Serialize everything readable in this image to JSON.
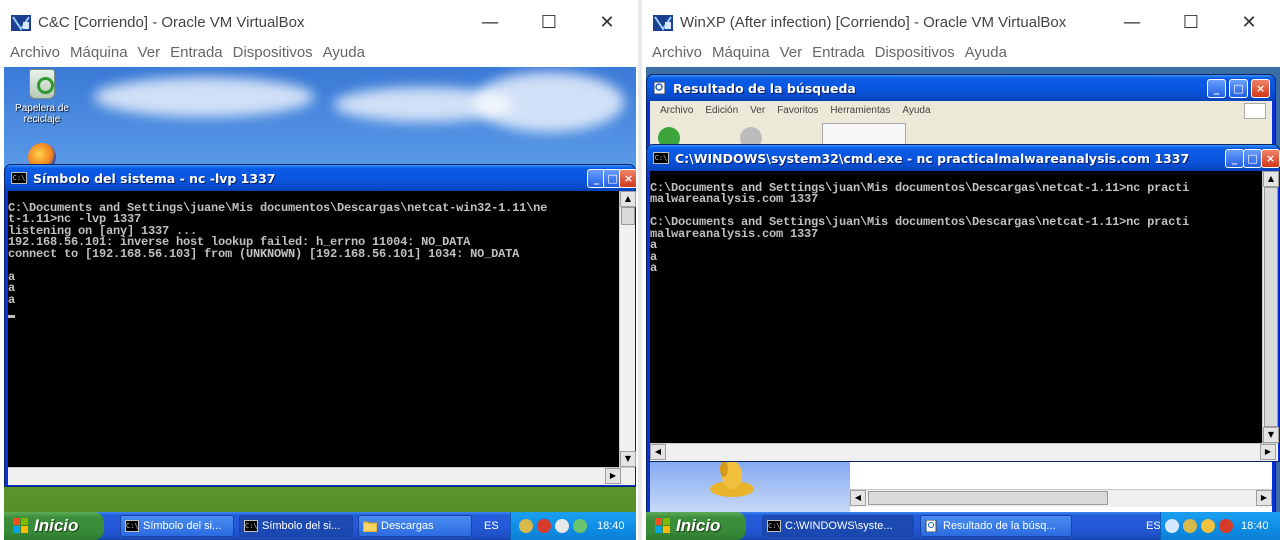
{
  "left_vm": {
    "window_title": "C&C [Corriendo] - Oracle VM VirtualBox",
    "menu": [
      "Archivo",
      "Máquina",
      "Ver",
      "Entrada",
      "Dispositivos",
      "Ayuda"
    ],
    "desktop_icons": [
      {
        "label": "Papelera de reciclaje",
        "icon": "recycle-bin-icon"
      },
      {
        "label": "",
        "icon": "firefox-icon"
      }
    ],
    "cmd_window": {
      "title": "Símbolo del sistema - nc -lvp 1337",
      "lines": [
        "",
        "C:\\Documents and Settings\\juane\\Mis documentos\\Descargas\\netcat-win32-1.11\\ne",
        "t-1.11>nc -lvp 1337",
        "listening on [any] 1337 ...",
        "192.168.56.101: inverse host lookup failed: h_errno 11004: NO_DATA",
        "connect to [192.168.56.103] from (UNKNOWN) [192.168.56.101] 1034: NO_DATA",
        "",
        "a",
        "a",
        "a"
      ]
    },
    "taskbar": {
      "start_label": "Inicio",
      "items": [
        {
          "label": "Símbolo del si...",
          "icon": "cmd-icon",
          "active": false
        },
        {
          "label": "Símbolo del si...",
          "icon": "cmd-icon",
          "active": true
        },
        {
          "label": "Descargas",
          "icon": "folder-icon",
          "active": false
        }
      ],
      "language": "ES",
      "clock": "18:40"
    }
  },
  "right_vm": {
    "window_title": "WinXP (After infection) [Corriendo] - Oracle VM VirtualBox",
    "menu": [
      "Archivo",
      "Máquina",
      "Ver",
      "Entrada",
      "Dispositivos",
      "Ayuda"
    ],
    "explorer_window": {
      "title": "Resultado de la búsqueda",
      "menu": [
        "Archivo",
        "Edición",
        "Ver",
        "Favoritos",
        "Herramientas",
        "Ayuda"
      ]
    },
    "cmd_window": {
      "title": "C:\\WINDOWS\\system32\\cmd.exe - nc practicalmalwareanalysis.com 1337",
      "lines": [
        "",
        "C:\\Documents and Settings\\juan\\Mis documentos\\Descargas\\netcat-1.11>nc practi",
        "malwareanalysis.com 1337",
        "",
        "C:\\Documents and Settings\\juan\\Mis documentos\\Descargas\\netcat-1.11>nc practi",
        "malwareanalysis.com 1337",
        "a",
        "a",
        "a"
      ]
    },
    "taskbar": {
      "start_label": "Inicio",
      "items": [
        {
          "label": "C:\\WINDOWS\\syste...",
          "icon": "cmd-icon",
          "active": true
        },
        {
          "label": "Resultado de la búsq...",
          "icon": "search-results-icon",
          "active": false
        }
      ],
      "language": "ES",
      "clock": "18:40"
    }
  },
  "colors": {
    "xp_title_blue": "#0a57e1",
    "xp_start_green": "#378a37",
    "console_bg": "#000000",
    "console_fg": "#c0c0c0"
  }
}
